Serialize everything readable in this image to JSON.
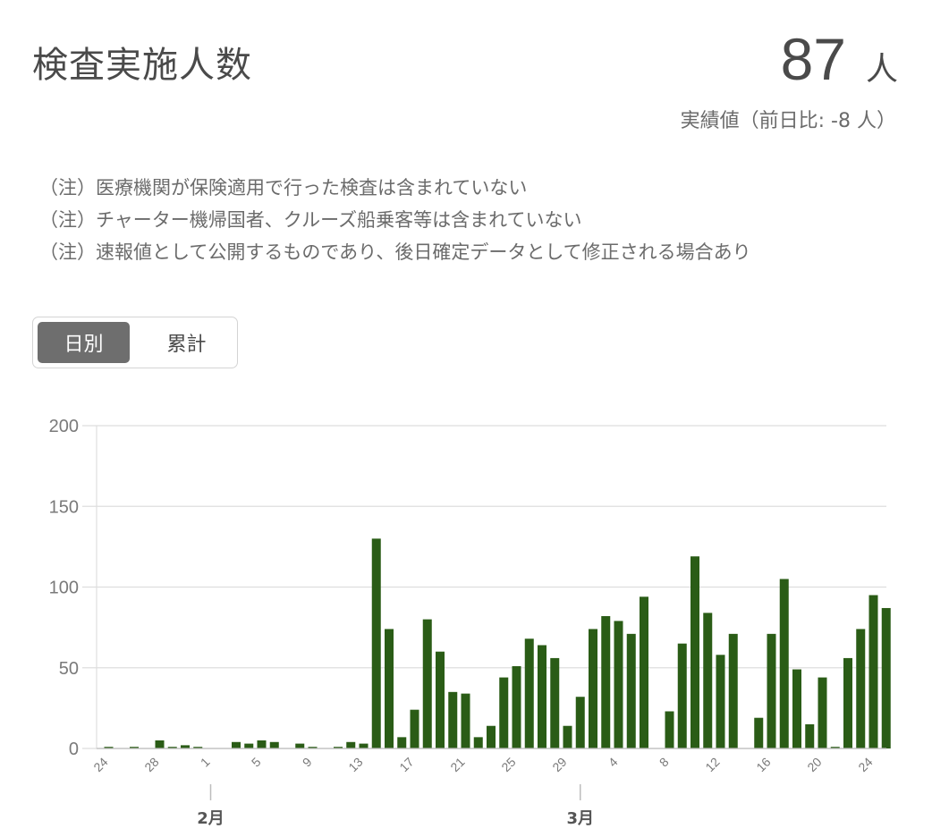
{
  "header": {
    "title": "検査実施人数",
    "value": "87",
    "unit": "人",
    "sub": "実績値（前日比: -8 人）"
  },
  "notes": [
    "（注）医療機関が保険適用で行った検査は含まれていない",
    "（注）チャーター機帰国者、クルーズ船乗客等は含まれていない",
    "（注）速報値として公開するものであり、後日確定データとして修正される場合あり"
  ],
  "toggle": {
    "daily": "日別",
    "cumulative": "累計",
    "selected": "daily"
  },
  "colors": {
    "bar": "#2a5c16",
    "grid": "#dedede",
    "axis": "#bdbdbd",
    "active_button": "#6e6e6e"
  },
  "chart_data": {
    "type": "bar",
    "title": "",
    "xlabel": "",
    "ylabel": "",
    "ylim": [
      0,
      200
    ],
    "yticks": [
      0,
      50,
      100,
      150,
      200
    ],
    "grid": true,
    "start_date": "1/24",
    "x_tick_labels": [
      "24",
      "28",
      "1",
      "5",
      "9",
      "13",
      "17",
      "21",
      "25",
      "29",
      "4",
      "8",
      "12",
      "16",
      "20",
      "24"
    ],
    "x_tick_days": [
      0,
      4,
      8,
      12,
      16,
      20,
      24,
      28,
      32,
      36,
      40,
      44,
      48,
      52,
      56,
      60
    ],
    "months": [
      {
        "label": "2月",
        "day": 8
      },
      {
        "label": "3月",
        "day": 37
      }
    ],
    "values": [
      1,
      0,
      1,
      0,
      5,
      1,
      2,
      1,
      0,
      0,
      4,
      3,
      5,
      4,
      0,
      3,
      1,
      0,
      1,
      4,
      3,
      130,
      74,
      7,
      24,
      80,
      60,
      35,
      34,
      7,
      14,
      44,
      51,
      68,
      64,
      56,
      14,
      32,
      74,
      82,
      79,
      71,
      94,
      0,
      23,
      65,
      119,
      84,
      58,
      71,
      0,
      19,
      71,
      105,
      49,
      15,
      44,
      1,
      56,
      74,
      95,
      87
    ]
  }
}
